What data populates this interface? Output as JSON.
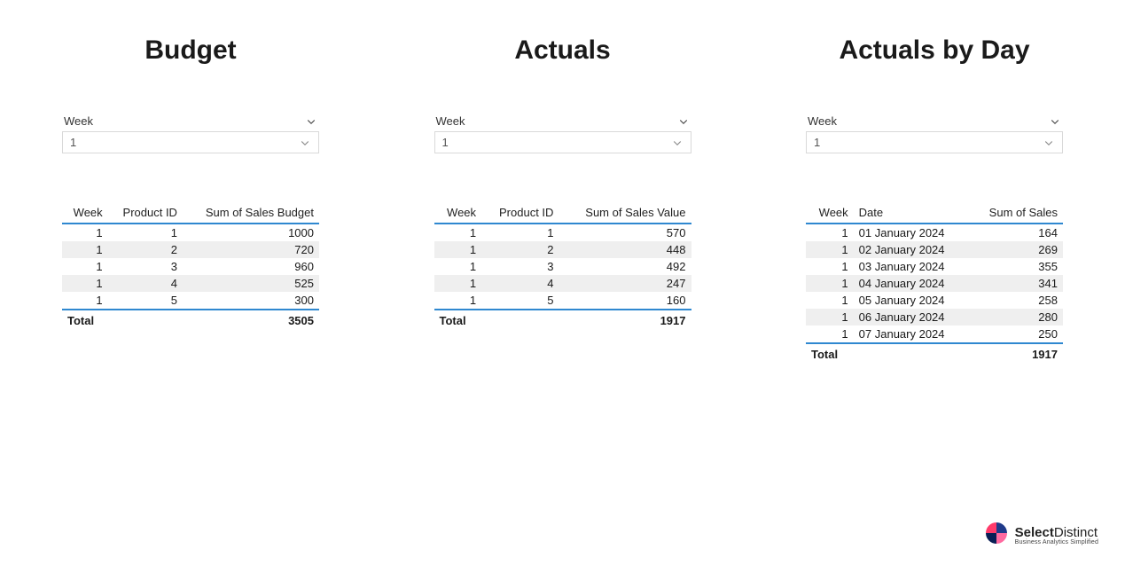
{
  "sections": [
    {
      "title": "Budget",
      "slicer_label": "Week",
      "slicer_value": "1",
      "headers": [
        "Week",
        "Product ID",
        "Sum of Sales Budget"
      ],
      "num_cols": [
        true,
        true,
        true
      ],
      "rows": [
        [
          "1",
          "1",
          "1000"
        ],
        [
          "1",
          "2",
          "720"
        ],
        [
          "1",
          "3",
          "960"
        ],
        [
          "1",
          "4",
          "525"
        ],
        [
          "1",
          "5",
          "300"
        ]
      ],
      "total_label": "Total",
      "total_value": "3505"
    },
    {
      "title": "Actuals",
      "slicer_label": "Week",
      "slicer_value": "1",
      "headers": [
        "Week",
        "Product ID",
        "Sum of Sales Value"
      ],
      "num_cols": [
        true,
        true,
        true
      ],
      "rows": [
        [
          "1",
          "1",
          "570"
        ],
        [
          "1",
          "2",
          "448"
        ],
        [
          "1",
          "3",
          "492"
        ],
        [
          "1",
          "4",
          "247"
        ],
        [
          "1",
          "5",
          "160"
        ]
      ],
      "total_label": "Total",
      "total_value": "1917"
    },
    {
      "title": "Actuals by Day",
      "slicer_label": "Week",
      "slicer_value": "1",
      "headers": [
        "Week",
        "Date",
        "Sum of Sales"
      ],
      "num_cols": [
        true,
        false,
        true
      ],
      "rows": [
        [
          "1",
          "01 January 2024",
          "164"
        ],
        [
          "1",
          "02 January 2024",
          "269"
        ],
        [
          "1",
          "03 January 2024",
          "355"
        ],
        [
          "1",
          "04 January 2024",
          "341"
        ],
        [
          "1",
          "05 January 2024",
          "258"
        ],
        [
          "1",
          "06 January 2024",
          "280"
        ],
        [
          "1",
          "07 January 2024",
          "250"
        ]
      ],
      "total_label": "Total",
      "total_value": "1917"
    }
  ],
  "logo": {
    "brand_bold": "Select",
    "brand_light": "Distinct",
    "tagline": "Business Analytics Simplified"
  }
}
